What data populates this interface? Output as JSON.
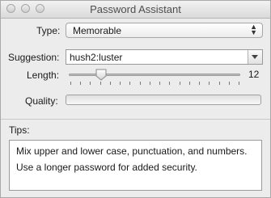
{
  "window": {
    "title": "Password Assistant"
  },
  "type": {
    "label": "Type:",
    "value": "Memorable"
  },
  "suggestion": {
    "label": "Suggestion:",
    "value": "hush2:luster"
  },
  "length": {
    "label": "Length:",
    "value": "12",
    "fraction": 0.167,
    "tick_count": 18
  },
  "quality": {
    "label": "Quality:",
    "level": 0
  },
  "tips": {
    "label": "Tips:",
    "lines": [
      "Mix upper and lower case, punctuation, and numbers.",
      "Use a longer password for added security."
    ]
  }
}
